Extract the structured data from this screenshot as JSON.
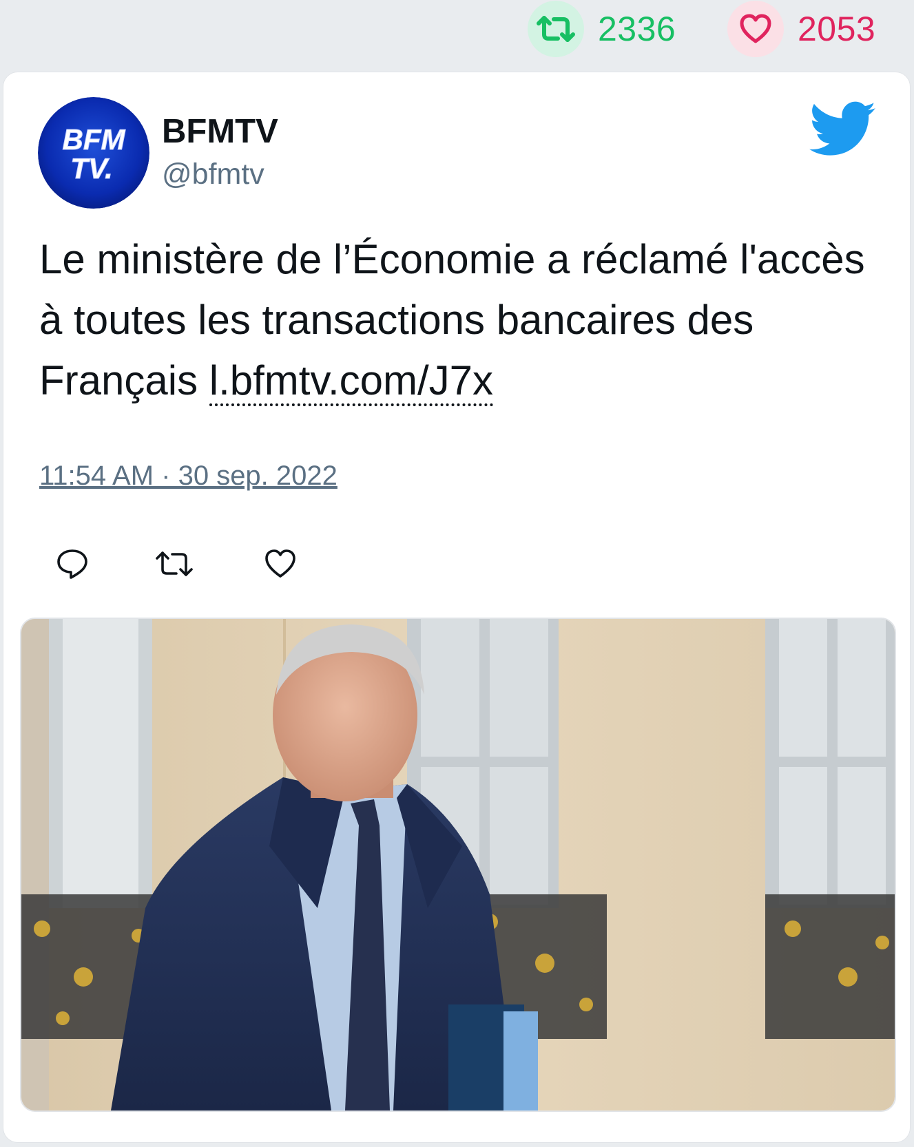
{
  "stats": {
    "retweets": "2336",
    "likes": "2053",
    "icons": [
      "retweet-icon",
      "heart-icon"
    ]
  },
  "tweet": {
    "author": {
      "display_name": "BFMTV",
      "handle": "@bfmtv",
      "avatar_text_line1": "BFM",
      "avatar_text_line2": "TV."
    },
    "text": "Le ministère de l’Économie a réclamé l'accès à toutes les transactions bancaires des Français ",
    "link": "l.bfmtv.com/J7x",
    "timestamp": "11:54 AM · 30 sep. 2022",
    "actions": [
      "reply-icon",
      "retweet-icon",
      "like-icon"
    ],
    "source_icon": "twitter-bird-icon"
  },
  "colors": {
    "retweet_green": "#17bf63",
    "like_red": "#e0245e",
    "twitter_blue": "#1d9bf0",
    "muted": "#5b7083",
    "text": "#0f1419"
  }
}
